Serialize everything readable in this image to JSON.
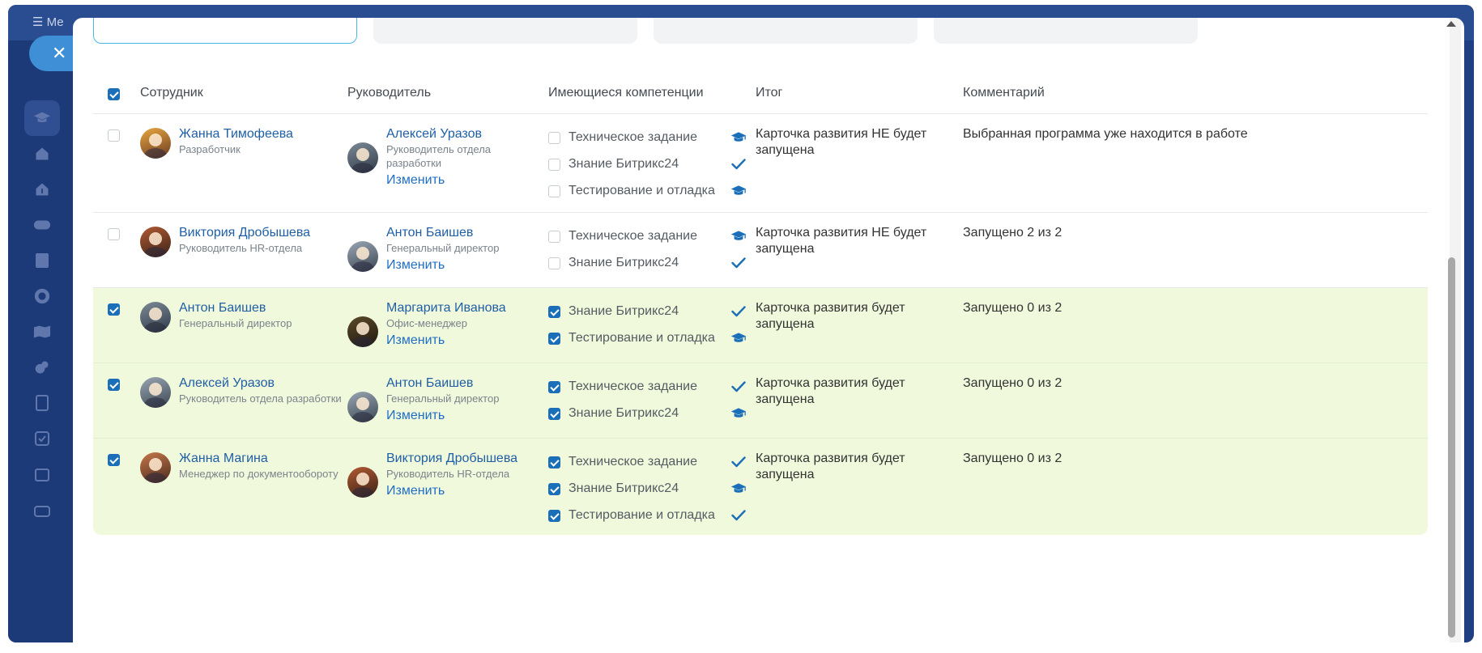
{
  "topbar": {
    "menu_label": "Ме"
  },
  "table": {
    "headers": {
      "employee": "Сотрудник",
      "manager": "Руководитель",
      "competencies": "Имеющиеся компетенции",
      "result": "Итог",
      "comment": "Комментарий"
    },
    "change_label": "Изменить",
    "rows": [
      {
        "employee": {
          "name": "Жанна Тимофеева",
          "role": "Разработчик"
        },
        "manager": {
          "name": "Алексей Уразов",
          "role": "Руководитель отдела разработки"
        },
        "competencies": [
          {
            "label": "Техническое задание",
            "icon": "graduation-cap-icon"
          },
          {
            "label": "Знание Битрикс24",
            "icon": "check-icon"
          },
          {
            "label": "Тестирование и отладка",
            "icon": "graduation-cap-icon"
          }
        ],
        "result": "Карточка развития НЕ будет запущена",
        "comment": "Выбранная программа уже находится в работе"
      },
      {
        "employee": {
          "name": "Виктория Дробышева",
          "role": "Руководитель HR-отдела"
        },
        "manager": {
          "name": "Антон Баишев",
          "role": "Генеральный директор"
        },
        "competencies": [
          {
            "label": "Техническое задание",
            "icon": "graduation-cap-icon"
          },
          {
            "label": "Знание Битрикс24",
            "icon": "check-icon"
          }
        ],
        "result": "Карточка развития НЕ будет запущена",
        "comment": "Запущено 2 из 2"
      },
      {
        "employee": {
          "name": "Антон Баишев",
          "role": "Генеральный директор"
        },
        "manager": {
          "name": "Маргарита Иванова",
          "role": "Офис-менеджер"
        },
        "competencies": [
          {
            "label": "Знание Битрикс24",
            "icon": "check-icon"
          },
          {
            "label": "Тестирование и отладка",
            "icon": "graduation-cap-icon"
          }
        ],
        "result": "Карточка развития будет запущена",
        "comment": "Запущено 0 из 2"
      },
      {
        "employee": {
          "name": "Алексей Уразов",
          "role": "Руководитель отдела разработки"
        },
        "manager": {
          "name": "Антон Баишев",
          "role": "Генеральный директор"
        },
        "competencies": [
          {
            "label": "Техническое задание",
            "icon": "check-icon"
          },
          {
            "label": "Знание Битрикс24",
            "icon": "graduation-cap-icon"
          }
        ],
        "result": "Карточка развития будет запущена",
        "comment": "Запущено 0 из 2"
      },
      {
        "employee": {
          "name": "Жанна Магина",
          "role": "Менеджер по документообороту"
        },
        "manager": {
          "name": "Виктория Дробышева",
          "role": "Руководитель HR-отдела"
        },
        "competencies": [
          {
            "label": "Техническое задание",
            "icon": "check-icon"
          },
          {
            "label": "Знание Битрикс24",
            "icon": "graduation-cap-icon"
          },
          {
            "label": "Тестирование и отладка",
            "icon": "check-icon"
          }
        ],
        "result": "Карточка развития будет запущена",
        "comment": "Запущено 0 из 2"
      }
    ]
  },
  "colors": {
    "accent": "#1a6fb8",
    "highlight_row": "#f1f9dc",
    "link": "#1f5fa6",
    "sidebar": "#1d3a78"
  }
}
